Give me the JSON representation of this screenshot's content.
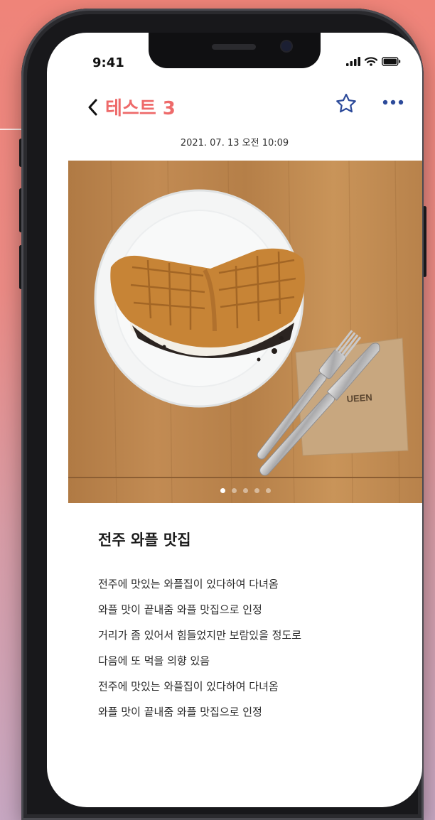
{
  "status_bar": {
    "time": "9:41"
  },
  "header": {
    "title": "테스트 3",
    "title_color": "#ee6a6a",
    "back_icon": "chevron-left-icon",
    "favorite_icon": "star-outline-icon",
    "more_icon": "more-horizontal-icon"
  },
  "post": {
    "datetime": "2021. 07. 13 오전 10:09",
    "photo": {
      "subject": "waffle-on-plate",
      "page_count": 5,
      "active_page": 1
    },
    "title": "전주 와플 맛집",
    "lines": [
      "전주에 맛있는 와플집이 있다하여 다녀옴",
      "와플 맛이 끝내줌 와플 맛집으로 인정",
      "거리가 좀 있어서 힘들었지만 보람있을 정도로",
      "다음에 또 먹을 의향 있음",
      "전주에 맛있는 와플집이 있다하여 다녀옴",
      "와플 맛이 끝내줌 와플 맛집으로 인정"
    ]
  },
  "napkin_text": "UEEN"
}
